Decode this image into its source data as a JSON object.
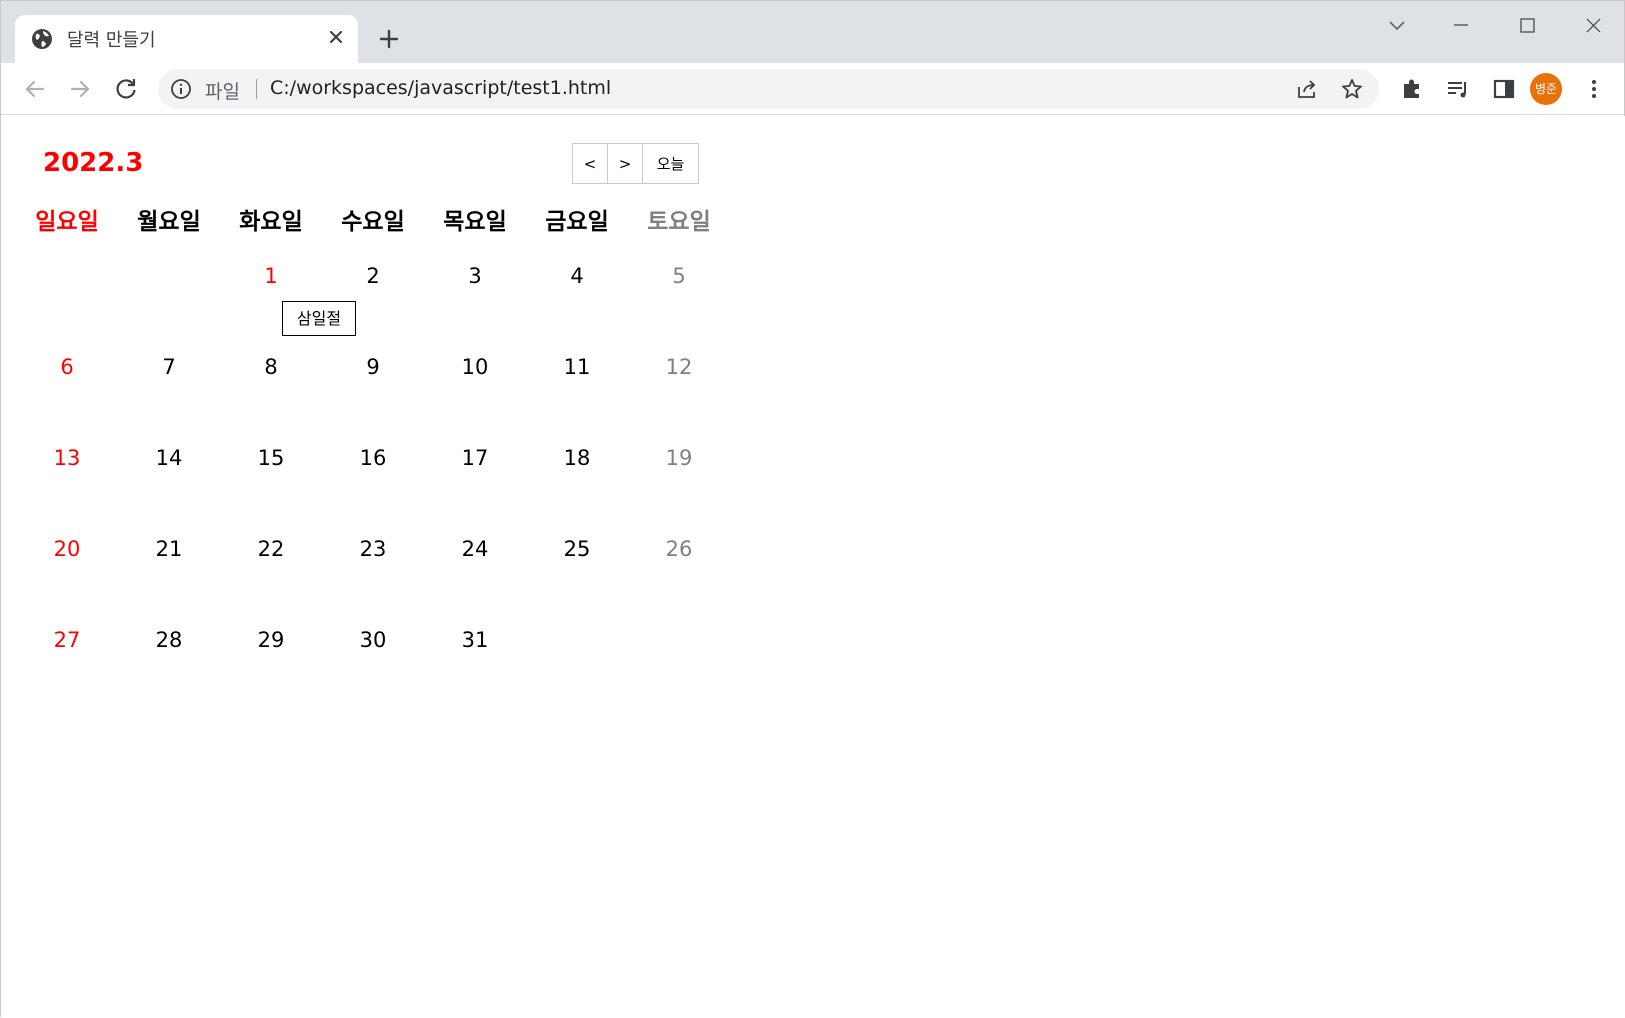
{
  "browser": {
    "tab_title": "달력 만들기",
    "omnibox": {
      "scheme_label": "파일",
      "url": "C:/workspaces/javascript/test1.html"
    },
    "profile_initials": "병준",
    "profile_color": "#e8710a"
  },
  "calendar": {
    "title": "2022.3",
    "title_color": "#ff0000",
    "nav": {
      "prev_label": "<",
      "next_label": ">",
      "today_label": "오늘"
    },
    "weekdays": [
      {
        "label": "일요일",
        "color": "#ff0000"
      },
      {
        "label": "월요일",
        "color": "#000000"
      },
      {
        "label": "화요일",
        "color": "#000000"
      },
      {
        "label": "수요일",
        "color": "#000000"
      },
      {
        "label": "목요일",
        "color": "#000000"
      },
      {
        "label": "금요일",
        "color": "#000000"
      },
      {
        "label": "토요일",
        "color": "#808080"
      }
    ],
    "weeks": [
      [
        null,
        null,
        {
          "day": "1",
          "holiday": true
        },
        {
          "day": "2"
        },
        {
          "day": "3"
        },
        {
          "day": "4"
        },
        {
          "day": "5"
        }
      ],
      [
        {
          "day": "6"
        },
        {
          "day": "7"
        },
        {
          "day": "8"
        },
        {
          "day": "9"
        },
        {
          "day": "10"
        },
        {
          "day": "11"
        },
        {
          "day": "12"
        }
      ],
      [
        {
          "day": "13"
        },
        {
          "day": "14"
        },
        {
          "day": "15"
        },
        {
          "day": "16"
        },
        {
          "day": "17"
        },
        {
          "day": "18"
        },
        {
          "day": "19"
        }
      ],
      [
        {
          "day": "20"
        },
        {
          "day": "21"
        },
        {
          "day": "22"
        },
        {
          "day": "23"
        },
        {
          "day": "24"
        },
        {
          "day": "25"
        },
        {
          "day": "26"
        }
      ],
      [
        {
          "day": "27"
        },
        {
          "day": "28"
        },
        {
          "day": "29"
        },
        {
          "day": "30"
        },
        {
          "day": "31"
        },
        null,
        null
      ]
    ],
    "holiday_name": "삼일절",
    "colors": {
      "sunday": "#ff0000",
      "weekday": "#000000",
      "saturday": "#808080",
      "holiday": "#ff0000"
    }
  }
}
